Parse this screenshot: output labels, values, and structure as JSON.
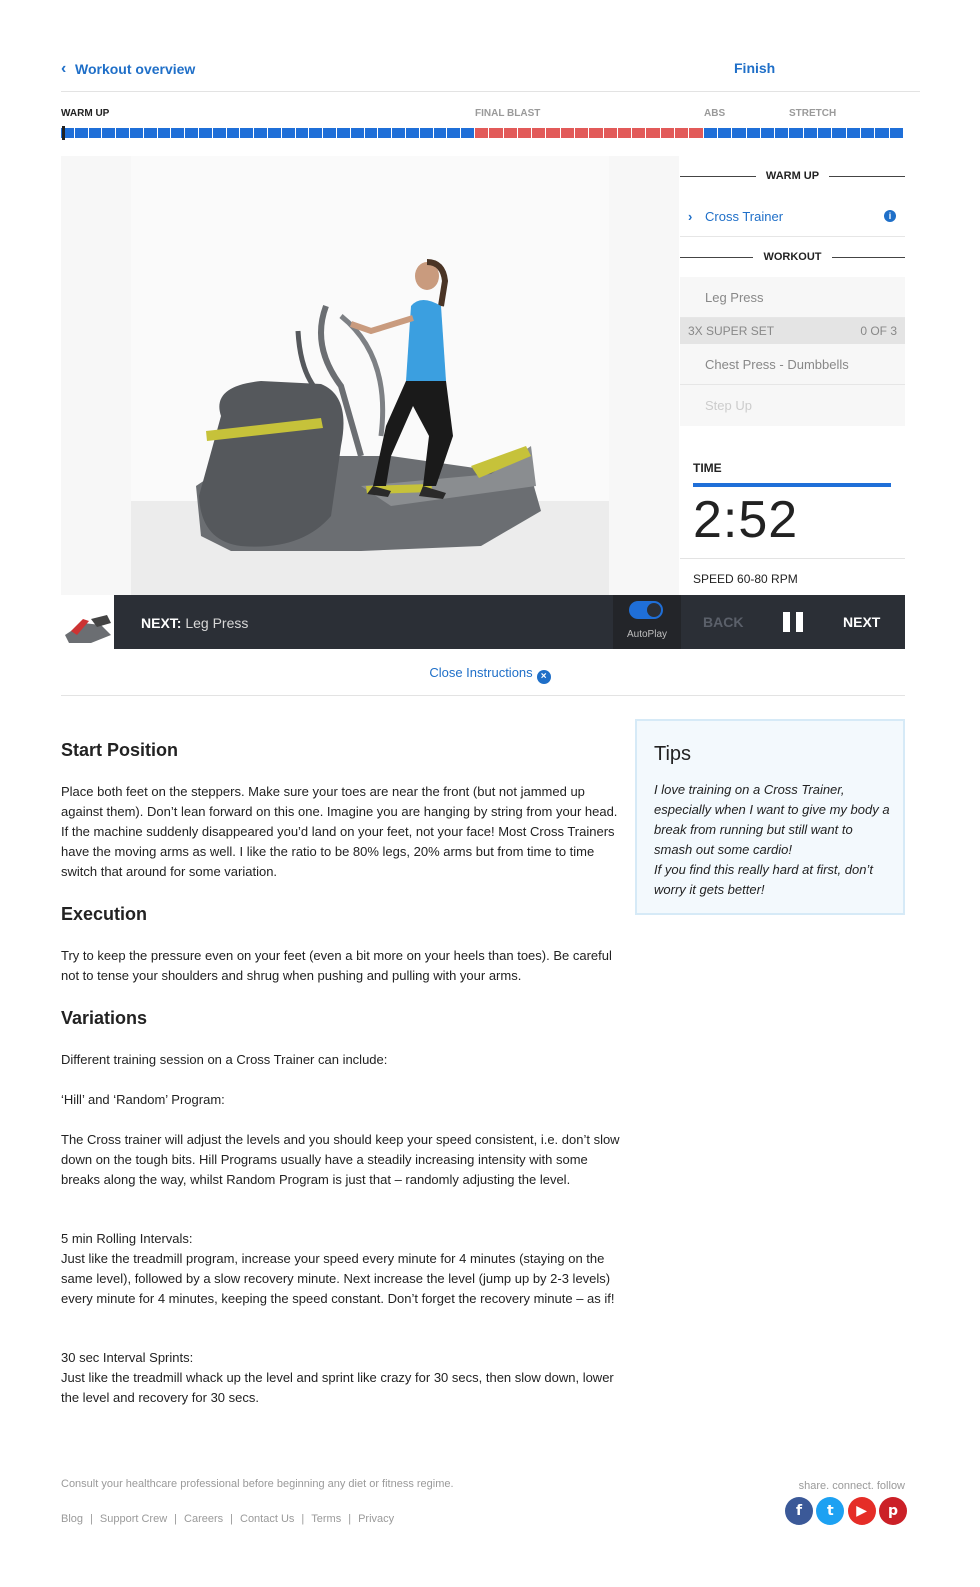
{
  "nav": {
    "back_label": "Workout overview",
    "finish_label": "Finish"
  },
  "progress": {
    "labels": [
      "WARM UP",
      "FINAL BLAST",
      "ABS",
      "STRETCH"
    ],
    "colors": {
      "warmup": "#1f6fd8",
      "final": "#e25a59"
    }
  },
  "side": {
    "warmup_heading": "WARM UP",
    "active_item": "Cross Trainer",
    "workout_heading": "WORKOUT",
    "item_leg_press": "Leg Press",
    "superset_label": "3X SUPER SET",
    "superset_count": "0 OF 3",
    "item_chest": "Chest Press - Dumbbells",
    "item_faded": "Step Up",
    "time_label": "TIME",
    "time_value": "2:52",
    "speed": "SPEED 60-80 RPM"
  },
  "controls": {
    "next_prefix": "NEXT:",
    "next_name": "Leg Press",
    "autoplay_label": "AutoPlay",
    "back_label": "BACK",
    "next_label": "NEXT"
  },
  "close_instructions": "Close Instructions",
  "instructions": {
    "start_heading": "Start Position",
    "start_text": "Place both feet on the steppers. Make sure your toes are near the front (but not jammed up against them). Don’t lean forward on this one. Imagine you are hanging by string from your head. If the machine suddenly disappeared you’d land on your feet, not your face! Most Cross Trainers have the moving arms as well. I like the ratio to be 80% legs, 20% arms but from time to time switch that around for some variation.",
    "exec_heading": "Execution",
    "exec_text": "Try to keep the pressure even on your feet (even a bit more on your heels than toes). Be careful not to tense your shoulders and shrug when pushing and pulling with your arms.",
    "var_heading": "Variations",
    "var_intro": "Different training session on a Cross Trainer can include:",
    "var_hill_title": "‘Hill’ and ‘Random’ Program:",
    "var_hill_text": "The Cross trainer will adjust the levels and you should keep your speed consistent, i.e. don’t slow down on the tough bits. Hill Programs usually have a steadily increasing intensity with some breaks along the way, whilst Random Program is just that – randomly adjusting the level.",
    "var_rolling_title": "5 min Rolling Intervals:",
    "var_rolling_text": "Just like the treadmill program, increase your speed every minute for 4 minutes (staying on the same level), followed by a slow recovery minute. Next increase the level (jump up by 2-3 levels) every minute for 4 minutes, keeping the speed constant. Don’t forget the recovery minute – as if!",
    "var_sprint_title": "30 sec Interval Sprints:",
    "var_sprint_text": "Just like the treadmill whack up the level and sprint like crazy for 30 secs, then slow down, lower the level and recovery for 30 secs."
  },
  "tips": {
    "heading": "Tips",
    "text1": "I love training on a Cross Trainer, especially when I want to give my body a break from running but still want to smash out some cardio!",
    "text2": "If you find this really hard at first, don’t worry it gets better!"
  },
  "footer": {
    "disclaimer": "Consult your healthcare professional before beginning any diet or fitness regime.",
    "links": [
      "Blog",
      "Support Crew",
      "Careers",
      "Contact Us",
      "Terms",
      "Privacy"
    ],
    "share_text": "share. connect. follow",
    "social": [
      {
        "icon": "facebook-icon",
        "glyph": "f",
        "color": "#3b5998"
      },
      {
        "icon": "twitter-icon",
        "glyph": "t",
        "color": "#1da1f2"
      },
      {
        "icon": "youtube-icon",
        "glyph": "▶",
        "color": "#e52d27"
      },
      {
        "icon": "pinterest-icon",
        "glyph": "p",
        "color": "#cb2027"
      }
    ]
  }
}
